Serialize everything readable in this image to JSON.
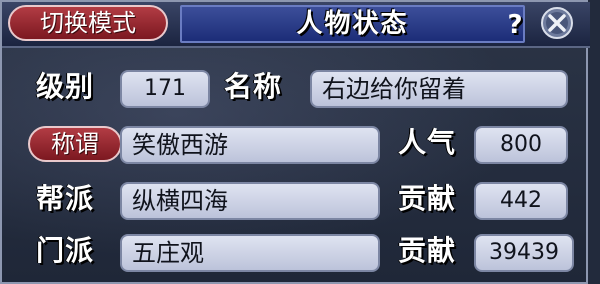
{
  "header": {
    "mode_button": "切换模式",
    "title": "人物状态",
    "help": "?",
    "close_icon": "close-x-circle-icon"
  },
  "fields": {
    "level_label": "级别",
    "level_value": "171",
    "name_label": "名称",
    "name_value": "右边给你留着",
    "nickname_label": "称谓",
    "nickname_value": "笑傲西游",
    "popularity_label": "人气",
    "popularity_value": "800",
    "guild_label": "帮派",
    "guild_value": "纵横四海",
    "guild_contribution_label": "贡献",
    "guild_contribution_value": "442",
    "sect_label": "门派",
    "sect_value": "五庄观",
    "sect_contribution_label": "贡献",
    "sect_contribution_value": "39439"
  },
  "colors": {
    "accent_red": "#b23c44",
    "title_blue": "#2a3c8c",
    "field_bg": "#cdd2e6"
  }
}
